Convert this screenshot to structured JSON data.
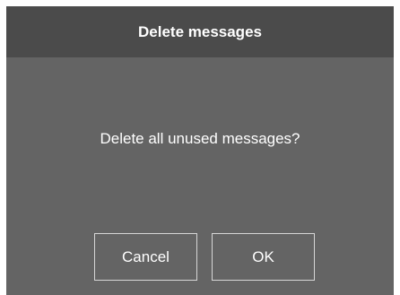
{
  "dialog": {
    "title": "Delete messages",
    "message": "Delete all unused messages?",
    "cancel_label": "Cancel",
    "ok_label": "OK"
  },
  "colors": {
    "header_background": "#4b4b4b",
    "dialog_background": "#646464",
    "text": "#ffffff",
    "button_border": "#d6d6d6"
  }
}
